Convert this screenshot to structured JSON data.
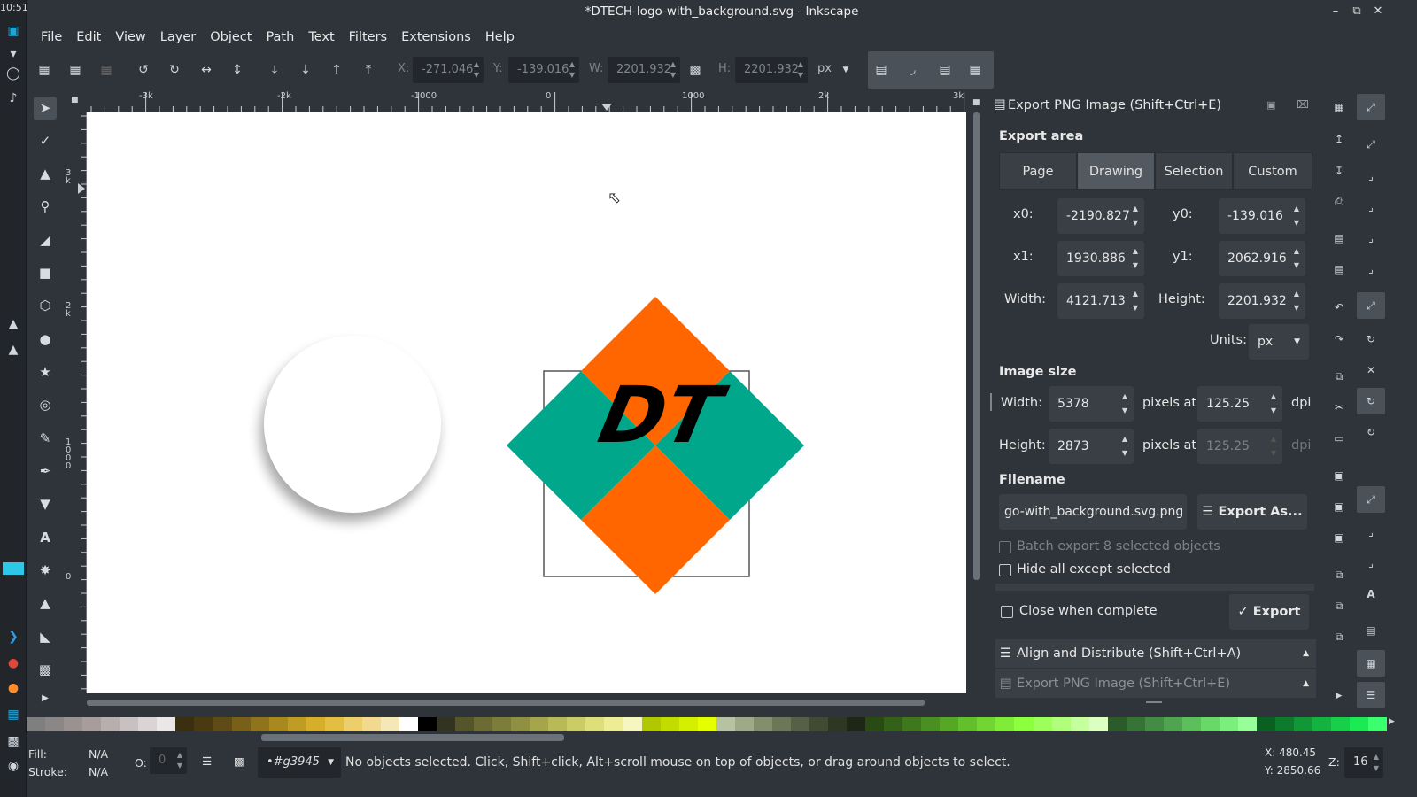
{
  "os": {
    "clock": "10:51"
  },
  "window": {
    "title": "*DTECH-logo-with_background.svg - Inkscape"
  },
  "menu": [
    "File",
    "Edit",
    "View",
    "Layer",
    "Object",
    "Path",
    "Text",
    "Filters",
    "Extensions",
    "Help"
  ],
  "toolbar": {
    "x_label": "X:",
    "x_value": "-271.046",
    "y_label": "Y:",
    "y_value": "-139.016",
    "w_label": "W:",
    "w_value": "2201.932",
    "h_label": "H:",
    "h_value": "2201.932",
    "unit": "px"
  },
  "ruler": {
    "h_ticks": [
      "-3k",
      "-2k",
      "-1000",
      "0",
      "1000",
      "2k",
      "3k"
    ],
    "v_ticks": [
      "3 k",
      "2 k",
      "1 0 0 0",
      "0"
    ]
  },
  "export_panel": {
    "title": "Export PNG Image (Shift+Ctrl+E)",
    "area_heading": "Export area",
    "area_tabs": [
      "Page",
      "Drawing",
      "Selection",
      "Custom"
    ],
    "active_tab": "Drawing",
    "x0_label": "x0:",
    "x0": "-2190.827",
    "y0_label": "y0:",
    "y0": "-139.016",
    "x1_label": "x1:",
    "x1": "1930.886",
    "y1_label": "y1:",
    "y1": "2062.916",
    "width_label": "Width:",
    "width": "4121.713",
    "height_label": "Height:",
    "height": "2201.932",
    "units_label": "Units:",
    "units": "px",
    "image_size_heading": "Image size",
    "img_width_label": "Width:",
    "img_width": "5378",
    "img_height_label": "Height:",
    "img_height": "2873",
    "pixels_at": "pixels at",
    "dpi_x": "125.25",
    "dpi_y": "125.25",
    "dpi": "dpi",
    "filename_heading": "Filename",
    "filename": "go-with_background.svg.png",
    "export_as": "Export As...",
    "batch_export": "Batch export 8 selected objects",
    "hide_all": "Hide all except selected",
    "close_when_complete": "Close when complete",
    "export": "Export",
    "docked_align": "Align and Distribute (Shift+Ctrl+A)",
    "docked_export": "Export PNG Image (Shift+Ctrl+E)"
  },
  "logo": {
    "text": "DT",
    "orange": "#ff6600",
    "teal": "#00a78a"
  },
  "status": {
    "fill_label": "Fill:",
    "fill_value": "N/A",
    "stroke_label": "Stroke:",
    "stroke_value": "N/A",
    "opacity_label": "O:",
    "opacity_value": "0",
    "layer": "•#g3945",
    "message": "No objects selected. Click, Shift+click, Alt+scroll mouse on top of objects, or drag around objects to select.",
    "cursor_x": "X:  480.45",
    "cursor_y": "Y: 2850.66",
    "zoom_label": "Z:",
    "zoom": "16"
  },
  "palette": [
    "#7f7f7f",
    "#8c8787",
    "#9a9191",
    "#a89c9c",
    "#b7aeae",
    "#c9c1c1",
    "#dad4d4",
    "#ebe7e7",
    "#3a2f10",
    "#4a3a12",
    "#5f4b15",
    "#786019",
    "#8f731d",
    "#a98820",
    "#c09c25",
    "#d6ae2a",
    "#e4be42",
    "#ecce6a",
    "#f1da8f",
    "#f6e7b6",
    "#ffffff",
    "#000000",
    "#333322",
    "#55552b",
    "#6b6b33",
    "#7d7d3b",
    "#909043",
    "#a5a54c",
    "#b9b957",
    "#cccc66",
    "#dede7a",
    "#eded96",
    "#f6f6c0",
    "#b0c800",
    "#c2dc00",
    "#d4ef00",
    "#e6ff00",
    "#b7c2a2",
    "#9caa87",
    "#818f6c",
    "#6b7858",
    "#556146",
    "#414b34",
    "#2f3724",
    "#1f2617",
    "#2a4a13",
    "#356018",
    "#3f781c",
    "#4a8f21",
    "#57a727",
    "#64bf2d",
    "#71d633",
    "#7eec39",
    "#8cff3f",
    "#9dff5a",
    "#b0ff7a",
    "#c6ff9d",
    "#dcffc2",
    "#2b5a2b",
    "#377337",
    "#438c43",
    "#4fa54f",
    "#5bbf5b",
    "#68d868",
    "#7bef7b",
    "#98ff98",
    "#0a5f22",
    "#0d7a2c",
    "#119736",
    "#14b340",
    "#18cf4a",
    "#1cea54",
    "#3bff6d"
  ]
}
